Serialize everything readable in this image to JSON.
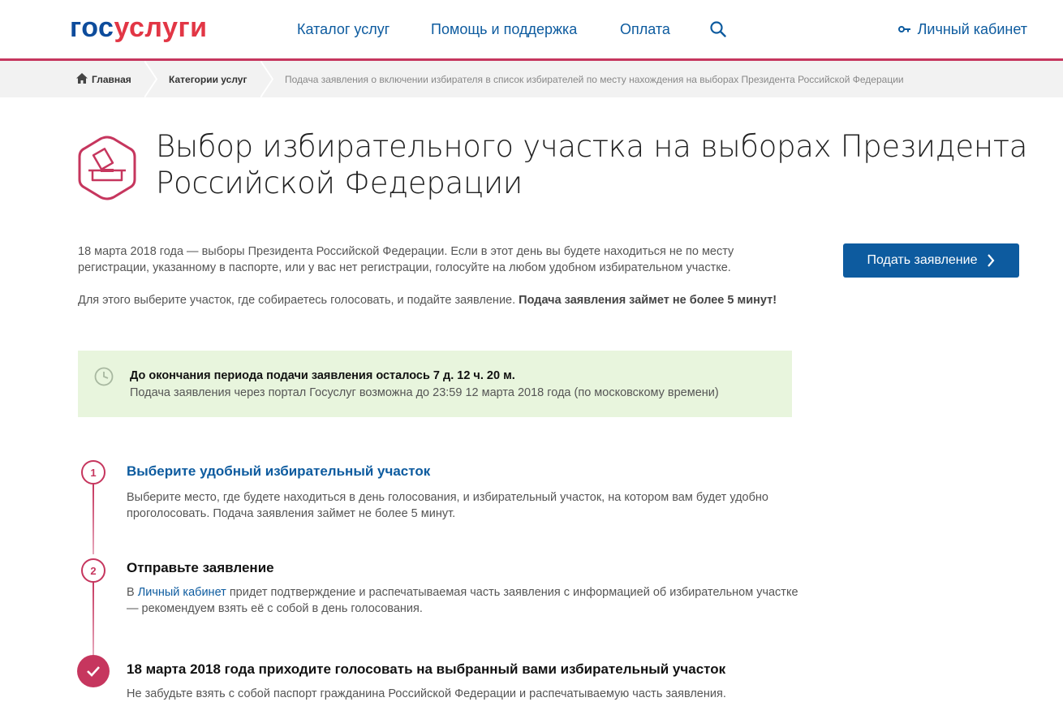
{
  "header": {
    "logo_part1": "гос",
    "logo_part2": "услуги",
    "nav": [
      "Каталог услуг",
      "Помощь и поддержка",
      "Оплата"
    ],
    "cabinet": "Личный кабинет",
    "icons": {
      "search": "search-icon",
      "key": "key-icon"
    }
  },
  "breadcrumb": {
    "home": "Главная",
    "categories": "Категории услуг",
    "current": "Подача заявления о включении избирателя в список избирателей по месту нахождения на выборах Президента Российской Федерации"
  },
  "page": {
    "title": "Выбор избирательного участка на выборах Президента Российской Федерации",
    "intro_p1": "18 марта 2018 года — выборы Президента Российской Федерации. Если в этот день вы будете находиться не по месту регистрации, указанному в паспорте, или у вас нет регистрации, голосуйте на любом удобном избирательном участке.",
    "intro_p2": "Для этого выберите участок, где собираетесь голосовать, и подайте заявление.",
    "intro_p2_bold": "Подача заявления займет не более 5 минут!",
    "apply_button": "Подать заявление"
  },
  "notice": {
    "title": "До окончания периода подачи заявления осталось 7 д. 12 ч. 20 м.",
    "text": "Подача заявления через портал Госуслуг возможна до 23:59 12 марта 2018 года (по московскому времени)"
  },
  "steps": [
    {
      "number": "1",
      "title": "Выберите удобный избирательный участок",
      "text": "Выберите место, где будете находиться в день голосования, и избирательный участок, на котором вам будет удобно проголосовать. Подача заявления займет не более 5 минут."
    },
    {
      "number": "2",
      "title": "Отправьте заявление",
      "text_before": "В",
      "link": "Личный кабинет",
      "text_after": "придет подтверждение и распечатываемая часть заявления с информацией об избирательном участке — рекомендуем взять её с собой в день голосования."
    },
    {
      "title": "18 марта 2018 года приходите голосовать на выбранный вами избирательный участок",
      "text": "Не забудьте взять с собой паспорт гражданина Российской Федерации и распечатываемую часть заявления."
    }
  ],
  "colors": {
    "brand_blue": "#0d5b9f",
    "brand_red": "#e23645",
    "accent": "#c6365e",
    "notice_bg": "#e8f5dd"
  }
}
